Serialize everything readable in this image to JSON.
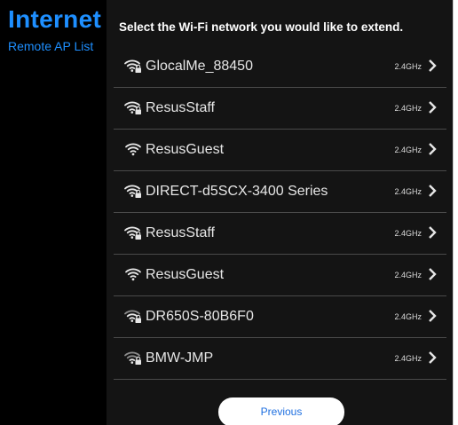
{
  "sidebar": {
    "title": "Internet",
    "link": "Remote AP List"
  },
  "main": {
    "instruction": "Select the Wi-Fi network you would like to extend.",
    "networks": [
      {
        "ssid": "GlocalMe_88450",
        "band": "2.4GHz",
        "secured": true,
        "icon": "wifi-lock-icon"
      },
      {
        "ssid": "ResusStaff",
        "band": "2.4GHz",
        "secured": true,
        "icon": "wifi-lock-icon"
      },
      {
        "ssid": "ResusGuest",
        "band": "2.4GHz",
        "secured": false,
        "icon": "wifi-icon"
      },
      {
        "ssid": "DIRECT-d5SCX-3400 Series",
        "band": "2.4GHz",
        "secured": true,
        "icon": "wifi-lock-icon"
      },
      {
        "ssid": "ResusStaff",
        "band": "2.4GHz",
        "secured": true,
        "icon": "wifi-lock-icon"
      },
      {
        "ssid": "ResusGuest",
        "band": "2.4GHz",
        "secured": false,
        "icon": "wifi-icon"
      },
      {
        "ssid": "DR650S-80B6F0",
        "band": "2.4GHz",
        "secured": true,
        "icon": "wifi-lock-icon"
      },
      {
        "ssid": "BMW-JMP",
        "band": "2.4GHz",
        "secured": true,
        "icon": "wifi-lock-icon"
      }
    ],
    "previous_label": "Previous"
  },
  "colors": {
    "accent": "#1e8fff",
    "background": "#141414",
    "sidebar_background": "#000000",
    "divider": "#4a4a4a",
    "button_text": "#1e6fe0"
  }
}
